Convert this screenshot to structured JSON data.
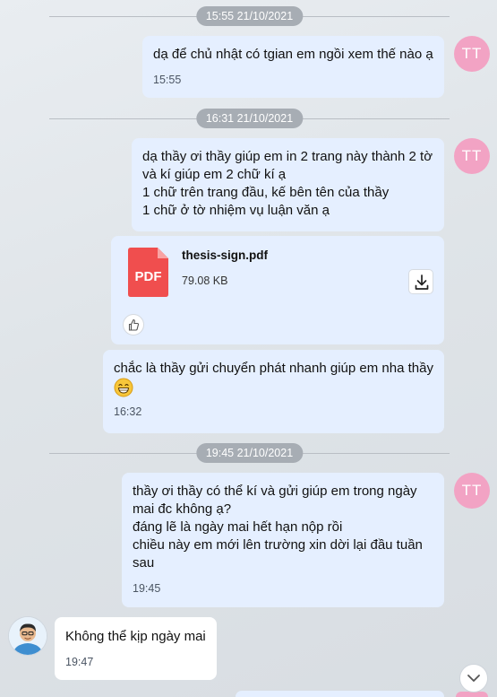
{
  "dividers": [
    "15:55 21/10/2021",
    "16:31 21/10/2021",
    "19:45 21/10/2021"
  ],
  "avatar_initials": "TT",
  "messages": [
    {
      "text": "dạ để chủ nhật có tgian em ngồi xem thế nào ạ",
      "time": "15:55"
    },
    {
      "text": "dạ thầy ơi thầy giúp em in 2 trang này thành 2 tờ\nvà kí giúp em 2 chữ kí ạ\n1 chữ trên trang đầu, kế bên tên của thầy\n1 chữ ở tờ nhiệm vụ luận văn ạ"
    },
    {
      "text": "chắc là thầy gửi chuyển phát nhanh giúp em nha thầy",
      "time": "16:32"
    },
    {
      "text": "thầy ơi thầy có thể kí và gửi giúp em trong ngày\nmai đc không ạ?\nđáng lẽ là ngày mai hết hạn nộp rồi\nchiều này em mới lên trường xin dời lại đầu tuần\nsau",
      "time": "19:45"
    },
    {
      "text": "Không thể kịp ngày mai",
      "time": "19:47"
    }
  ],
  "file": {
    "icon_label": "PDF",
    "name": "thesis-sign.pdf",
    "size": "79.08 KB"
  },
  "colors": {
    "own_bubble": "#e5efff",
    "other_bubble": "#ffffff",
    "avatar_pink": "#f2a3c4",
    "pdf_red": "#f04e4e",
    "divider_pill": "#a7adb4"
  },
  "icons": [
    "download-icon",
    "thumbs-up-icon",
    "chevron-down-icon",
    "grinning-emoji"
  ]
}
